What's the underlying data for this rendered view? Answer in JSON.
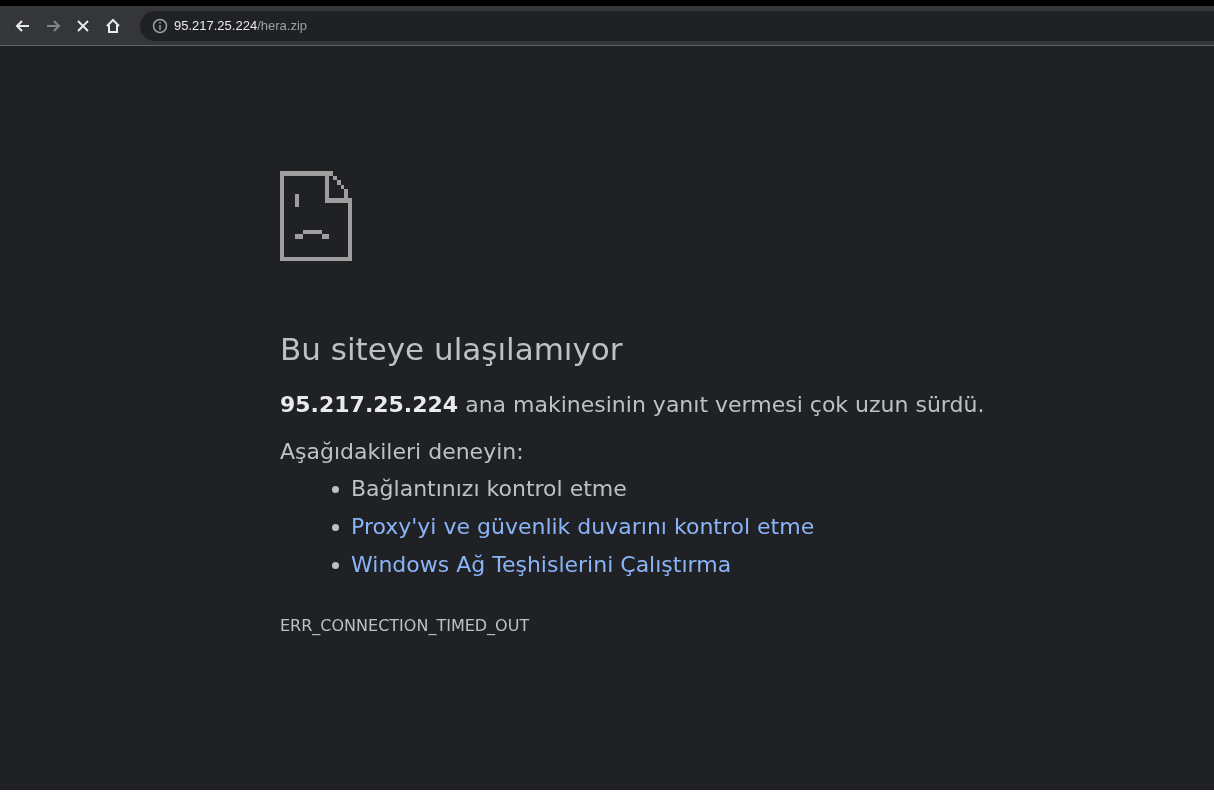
{
  "toolbar": {
    "nav_buttons": [
      {
        "kind": "back",
        "disabled": false
      },
      {
        "kind": "forward",
        "disabled": true
      },
      {
        "kind": "stop",
        "disabled": false
      },
      {
        "kind": "home",
        "disabled": false
      }
    ],
    "address": {
      "host": "95.217.25.224",
      "path": "/hera.zip"
    }
  },
  "error_page": {
    "heading": "Bu siteye ulaşılamıyor",
    "message": "**95.217.25.224** ana makinesinin yanıt vermesi çok uzun sürdü.",
    "suggestions_intro": "Aşağıdakileri deneyin:",
    "suggestions": [
      {
        "kind": "text",
        "label": "Bağlantınızı kontrol etme"
      },
      {
        "kind": "link",
        "label": "Proxy'yi ve güvenlik duvarını kontrol etme"
      },
      {
        "kind": "link",
        "label": "Windows Ağ Teşhislerini Çalıştırma"
      }
    ],
    "error_code": "ERR_CONNECTION_TIMED_OUT"
  }
}
